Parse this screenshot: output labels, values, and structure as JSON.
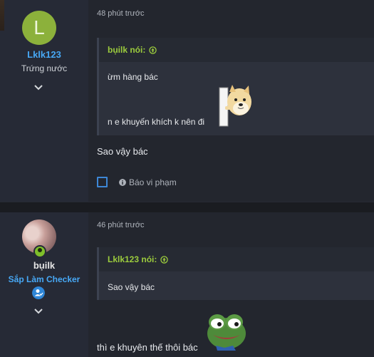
{
  "posts": [
    {
      "author": {
        "avatar_letter": "L",
        "name": "Lklk123",
        "title": "Trứng nước"
      },
      "time": "48 phút trước",
      "quote": {
        "author_label": "bụilk nói:",
        "lines": [
          "ừm hàng bác",
          "n e khuyến khích k nên đi"
        ]
      },
      "message": "Sao vậy bác",
      "report_label": "Báo vi phạm"
    },
    {
      "author": {
        "name": "bụilk",
        "title": "Sắp Làm Checker"
      },
      "time": "46 phút trước",
      "quote": {
        "author_label": "Lklk123 nói:",
        "lines": [
          "Sao vậy bác"
        ]
      },
      "message": "thì e khuyên thế thôi bác"
    }
  ],
  "colors": {
    "accent_blue": "#47a8f5",
    "quote_green": "#9ccc3d",
    "online_green": "#7fbf2a"
  }
}
